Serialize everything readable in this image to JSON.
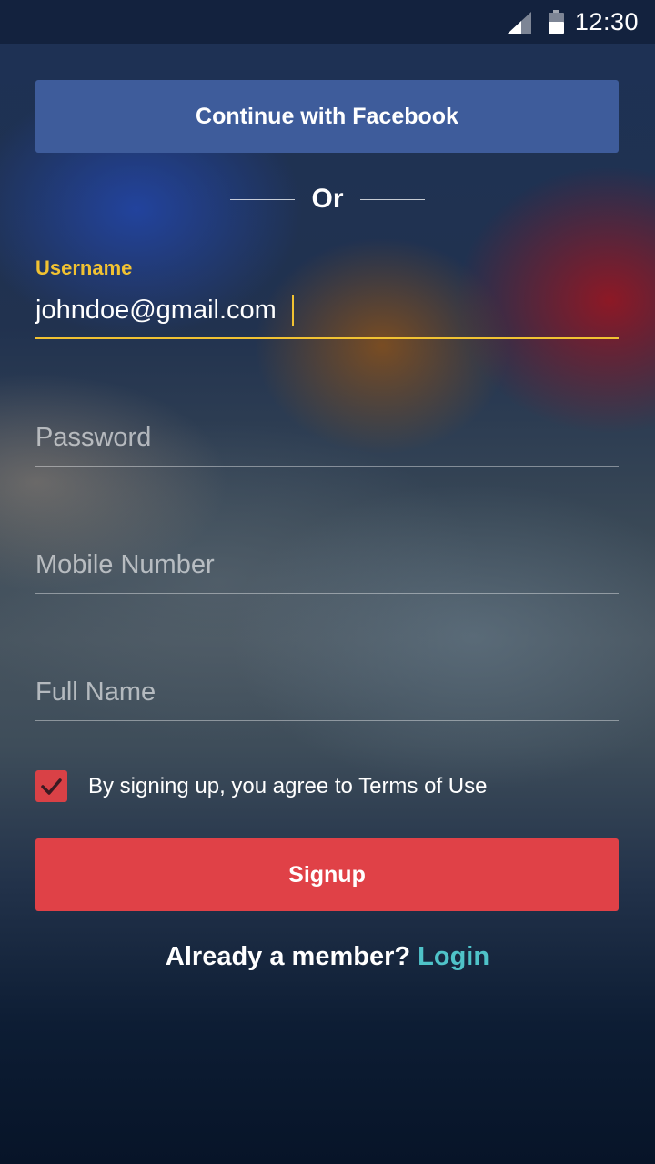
{
  "status_bar": {
    "time": "12:30",
    "signal_icon": "cellular-signal-icon",
    "battery_icon": "battery-icon"
  },
  "facebook_button": {
    "label": "Continue with Facebook",
    "color": "#3e5c9b"
  },
  "divider": {
    "label": "Or"
  },
  "fields": {
    "username": {
      "label": "Username",
      "value": "johndoe@gmail.com",
      "focused": true
    },
    "password": {
      "placeholder": "Password"
    },
    "mobile": {
      "placeholder": "Mobile Number"
    },
    "full_name": {
      "placeholder": "Full Name"
    }
  },
  "terms": {
    "checked": true,
    "text": "By signing up, you agree to Terms of Use"
  },
  "signup_button": {
    "label": "Signup",
    "color": "#e04147"
  },
  "login_prompt": {
    "text": "Already a member?",
    "link": "Login"
  },
  "colors": {
    "accent_yellow": "#f1c232",
    "link_teal": "#4fc3c9"
  }
}
